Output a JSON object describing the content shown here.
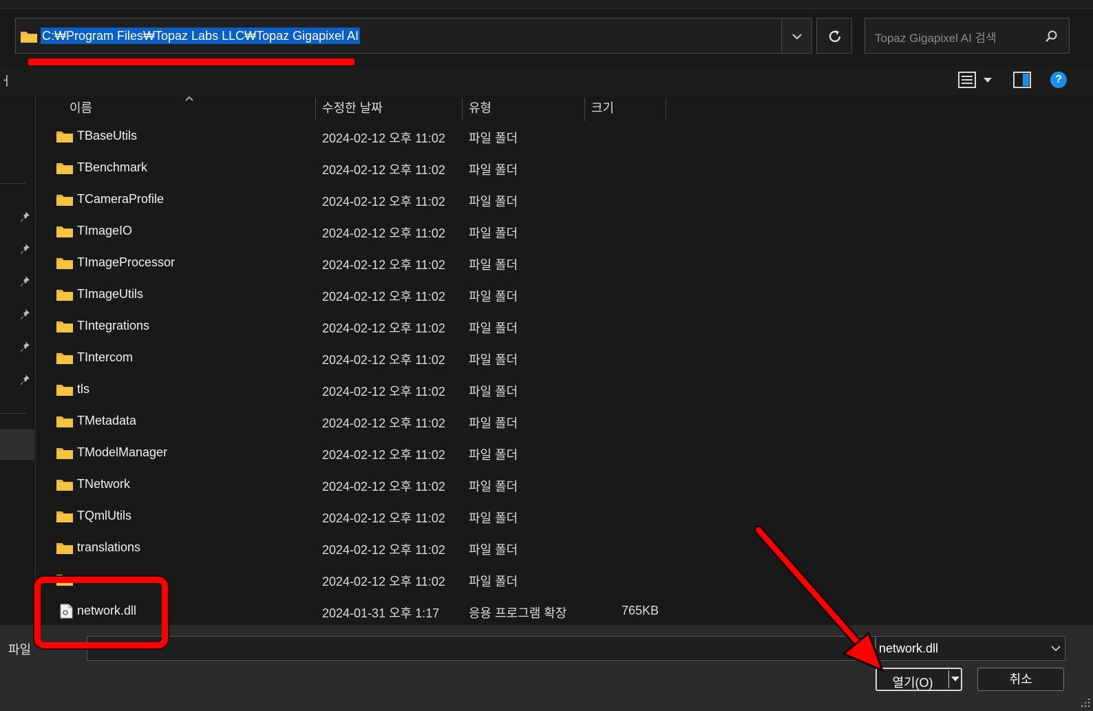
{
  "address": {
    "path": "C:₩Program Files₩Topaz Labs LLC₩Topaz Gigapixel AI",
    "search_placeholder": "Topaz Gigapixel AI 검색"
  },
  "toolbar": {
    "left_label": "ㅓ"
  },
  "columns": {
    "name": "이름",
    "modified": "수정한 날짜",
    "type": "유형",
    "size": "크기"
  },
  "files": [
    {
      "name": "TBaseUtils",
      "modified": "2024-02-12 오후 11:02",
      "type": "파일 폴더",
      "size": "",
      "icon": "folder-icon"
    },
    {
      "name": "TBenchmark",
      "modified": "2024-02-12 오후 11:02",
      "type": "파일 폴더",
      "size": "",
      "icon": "folder-icon"
    },
    {
      "name": "TCameraProfile",
      "modified": "2024-02-12 오후 11:02",
      "type": "파일 폴더",
      "size": "",
      "icon": "folder-icon"
    },
    {
      "name": "TImageIO",
      "modified": "2024-02-12 오후 11:02",
      "type": "파일 폴더",
      "size": "",
      "icon": "folder-icon"
    },
    {
      "name": "TImageProcessor",
      "modified": "2024-02-12 오후 11:02",
      "type": "파일 폴더",
      "size": "",
      "icon": "folder-icon"
    },
    {
      "name": "TImageUtils",
      "modified": "2024-02-12 오후 11:02",
      "type": "파일 폴더",
      "size": "",
      "icon": "folder-icon"
    },
    {
      "name": "TIntegrations",
      "modified": "2024-02-12 오후 11:02",
      "type": "파일 폴더",
      "size": "",
      "icon": "folder-icon"
    },
    {
      "name": "TIntercom",
      "modified": "2024-02-12 오후 11:02",
      "type": "파일 폴더",
      "size": "",
      "icon": "folder-icon"
    },
    {
      "name": "tls",
      "modified": "2024-02-12 오후 11:02",
      "type": "파일 폴더",
      "size": "",
      "icon": "folder-icon"
    },
    {
      "name": "TMetadata",
      "modified": "2024-02-12 오후 11:02",
      "type": "파일 폴더",
      "size": "",
      "icon": "folder-icon"
    },
    {
      "name": "TModelManager",
      "modified": "2024-02-12 오후 11:02",
      "type": "파일 폴더",
      "size": "",
      "icon": "folder-icon"
    },
    {
      "name": "TNetwork",
      "modified": "2024-02-12 오후 11:02",
      "type": "파일 폴더",
      "size": "",
      "icon": "folder-icon"
    },
    {
      "name": "TQmlUtils",
      "modified": "2024-02-12 오후 11:02",
      "type": "파일 폴더",
      "size": "",
      "icon": "folder-icon"
    },
    {
      "name": "translations",
      "modified": "2024-02-12 오후 11:02",
      "type": "파일 폴더",
      "size": "",
      "icon": "folder-icon"
    },
    {
      "name": "",
      "modified": "2024-02-12 오후 11:02",
      "type": "파일 폴더",
      "size": "",
      "icon": "folder-icon"
    },
    {
      "name": "network.dll",
      "modified": "2024-01-31 오후 1:17",
      "type": "응용 프로그램 확장",
      "size": "765KB",
      "icon": "dll-file-icon"
    }
  ],
  "bottom": {
    "filename_label": "파일",
    "filter_value": "network.dll",
    "open_label": "열기(O)",
    "cancel_label": "취소"
  },
  "colors": {
    "accent": "#0a5fc5",
    "annotation": "#ff0000",
    "folder": "#f4c441",
    "help": "#1a8ee8"
  }
}
